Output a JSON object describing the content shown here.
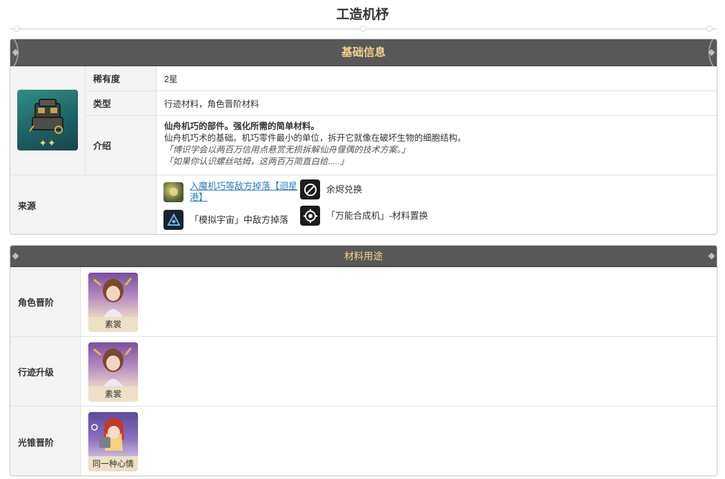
{
  "page": {
    "title": "工造机杼"
  },
  "basic_info": {
    "header": "基础信息",
    "rarity": {
      "label": "稀有度",
      "value": "2星"
    },
    "type": {
      "label": "类型",
      "value": "行迹材料，角色晋阶材料"
    },
    "intro": {
      "label": "介绍",
      "bold": "仙舟机巧的部件。强化所需的简单材料。",
      "line": "仙舟机巧术的基础。机巧零件最小的单位，拆开它就像在破坏生物的细胞结构。",
      "quote1": "「博识学会以两百万信用点悬赏无损拆解仙舟偃偶的技术方案。」",
      "quote2": "「如果你认识螺丝咕姆，这两百万简直白给.....」"
    },
    "stars": "✦✦",
    "source": {
      "label": "来源",
      "items": [
        {
          "text": "入魔机巧等敌方掉落【迴星港】",
          "icon": "enemy-drop-icon"
        },
        {
          "text": "余烬兑换",
          "icon": "ember-exchange-icon"
        },
        {
          "text": "「模拟宇宙」中敌方掉落",
          "icon": "simulated-universe-icon"
        },
        {
          "text": "「万能合成机」-材料置换",
          "icon": "synthesizer-icon"
        }
      ]
    }
  },
  "usage": {
    "header": "材料用途",
    "rows": [
      {
        "label": "角色晋阶",
        "card_name": "素裳"
      },
      {
        "label": "行迹升级",
        "card_name": "素裳"
      },
      {
        "label": "光锥晋阶",
        "card_name": "同一种心情"
      }
    ]
  },
  "colors": {
    "header_bg": "#585858",
    "header_text": "#f5d28c",
    "link": "#2a7fc0",
    "label_bg": "#f4f4f4"
  }
}
